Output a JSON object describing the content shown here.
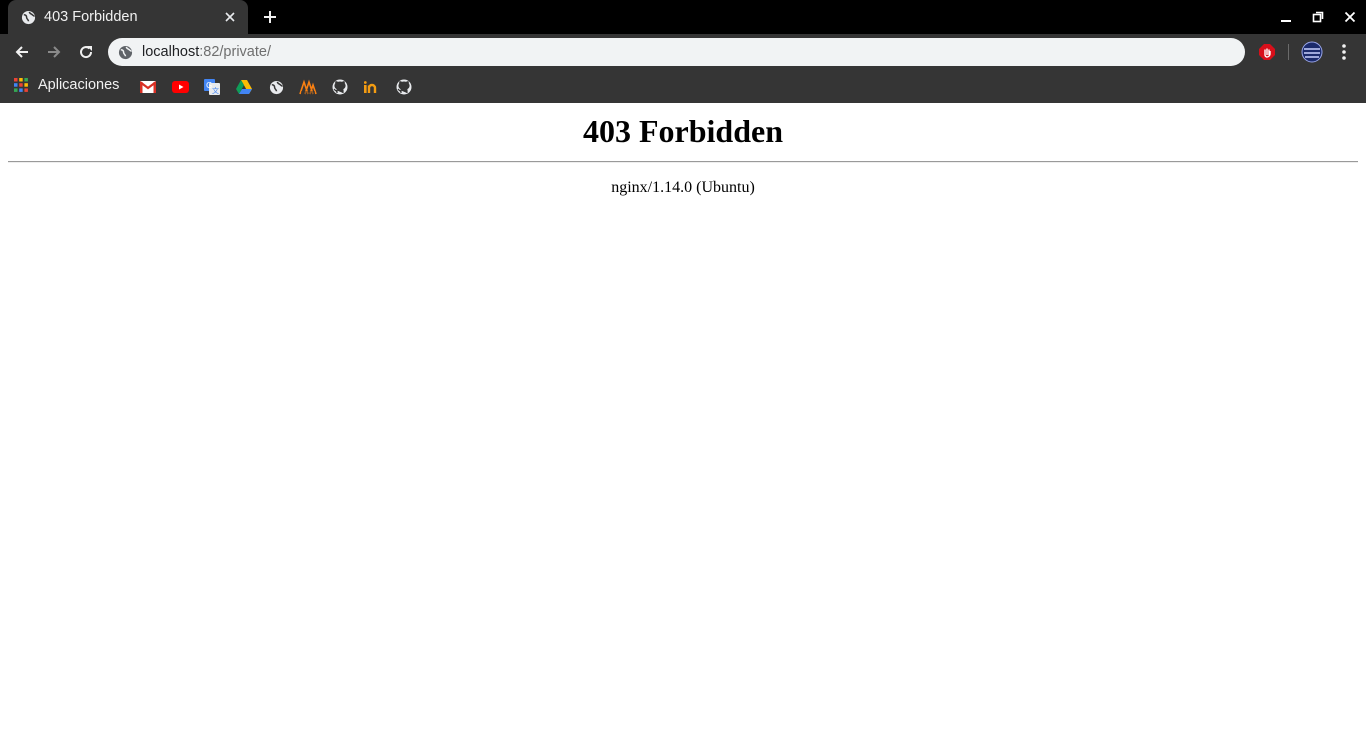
{
  "browser": {
    "tab": {
      "title": "403 Forbidden",
      "favicon": "globe-icon"
    },
    "address_bar": {
      "host": "localhost",
      "rest": ":82/private/",
      "security_icon": "globe-icon"
    },
    "bookmarks": {
      "apps_label": "Aplicaciones",
      "items": [
        "gmail-icon",
        "youtube-icon",
        "google-translate-icon",
        "google-drive-icon",
        "globe-icon",
        "moodle-icon",
        "github-icon",
        "invision-icon",
        "github-icon"
      ]
    },
    "colors": {
      "frame": "#000000",
      "toolbar": "#353535",
      "omnibox": "#f1f3f4"
    }
  },
  "page": {
    "heading": "403 Forbidden",
    "server_signature": "nginx/1.14.0 (Ubuntu)"
  }
}
